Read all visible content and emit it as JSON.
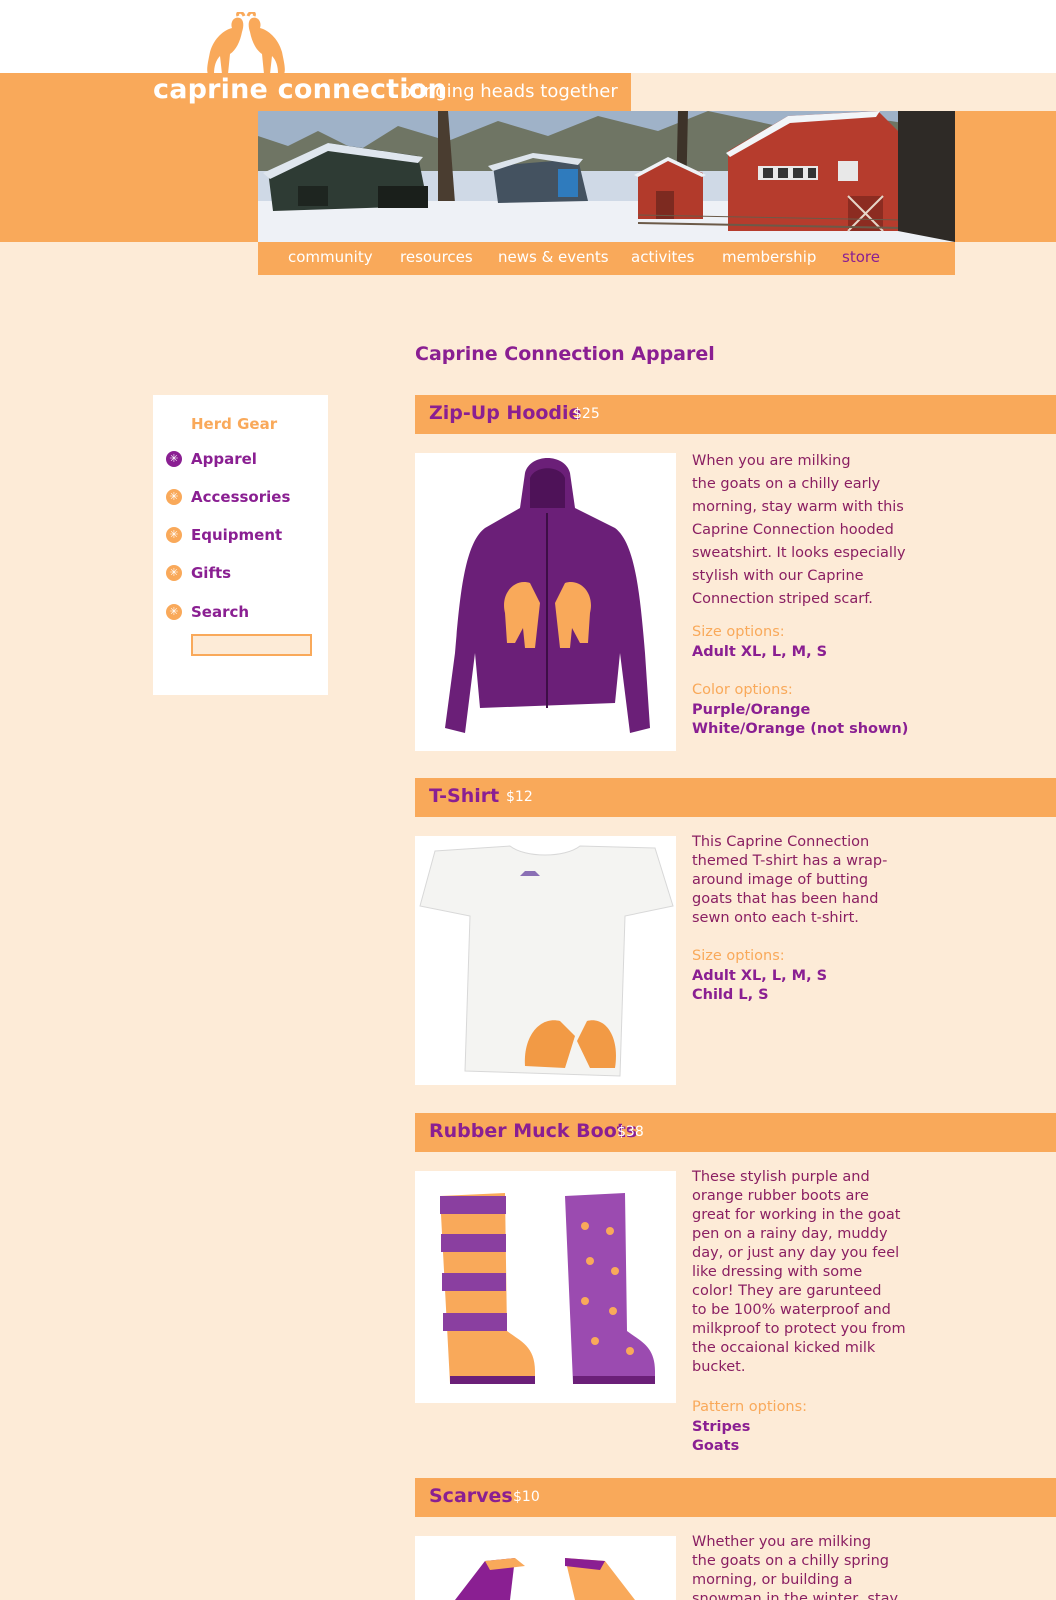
{
  "header": {
    "brand": "caprine connection",
    "tagline": "bringing heads together"
  },
  "nav": {
    "items": [
      "community",
      "resources",
      "news & events",
      "activites",
      "membership",
      "store"
    ],
    "active": "store"
  },
  "sidebar": {
    "title": "Herd Gear",
    "items": [
      "Apparel",
      "Accessories",
      "Equipment",
      "Gifts",
      "Search"
    ],
    "search_placeholder": ""
  },
  "main": {
    "title": "Caprine Connection Apparel",
    "products": [
      {
        "name": "Zip-Up Hoodie",
        "price": "$25",
        "desc_lines": [
          "When you are milking",
          "the goats on a chilly early",
          "morning, stay warm with this",
          "Caprine Connection hooded",
          "sweatshirt. It looks especially",
          "stylish with our Caprine",
          "Connection striped scarf."
        ],
        "options": [
          {
            "label": "Size options:",
            "values": [
              "Adult XL, L, M, S"
            ]
          },
          {
            "label": "Color options:",
            "values": [
              "Purple/Orange",
              "White/Orange (not shown)"
            ]
          }
        ]
      },
      {
        "name": "T-Shirt",
        "price": "$12",
        "desc_lines": [
          "This Caprine Connection",
          "themed T-shirt has a wrap-",
          "around image of butting",
          "goats that has been hand",
          "sewn onto each t-shirt."
        ],
        "options": [
          {
            "label": "Size options:",
            "values": [
              "Adult XL, L, M, S",
              "Child L, S"
            ]
          }
        ]
      },
      {
        "name": "Rubber Muck Boots",
        "price": "$38",
        "desc_lines": [
          "These stylish purple and",
          "orange rubber boots are",
          "great for working in the goat",
          "pen on a rainy day, muddy",
          "day, or just any day you feel",
          "like dressing with some",
          "color! They are garunteed",
          "to be 100% waterproof and",
          "milkproof to protect you from",
          "the occaional kicked milk",
          "bucket."
        ],
        "options": [
          {
            "label": "Pattern options:",
            "values": [
              "Stripes",
              "Goats"
            ]
          }
        ]
      },
      {
        "name": "Scarves",
        "price": "$10",
        "desc_lines": [
          "Whether you are milking",
          "the goats on a chilly spring",
          "morning, or building a",
          "snowman in the winter, stay"
        ],
        "options": []
      }
    ]
  },
  "colors": {
    "orange": "#f9a95a",
    "purple": "#8a1f92",
    "cream": "#fdebd7"
  }
}
